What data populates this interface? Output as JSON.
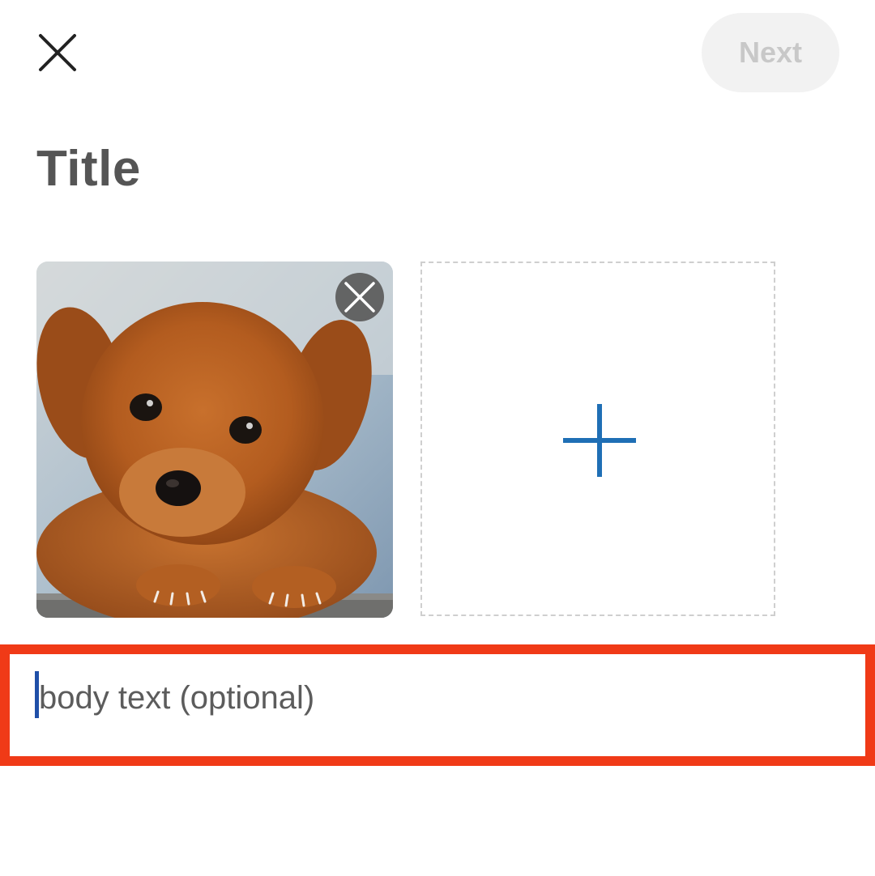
{
  "header": {
    "close_icon": "close-icon",
    "next_label": "Next"
  },
  "post": {
    "title_placeholder": "Title",
    "body_placeholder": "body text (optional)"
  },
  "media": {
    "items": [
      {
        "kind": "image",
        "subject": "puppy",
        "remove_icon": "remove-circle-icon"
      }
    ],
    "add_icon": "plus-icon"
  },
  "colors": {
    "accent": "#1f6fb5",
    "highlight": "#f03a17",
    "disabled_bg": "#f2f2f2",
    "disabled_text": "#c8c8c8",
    "title_text": "#555555"
  }
}
